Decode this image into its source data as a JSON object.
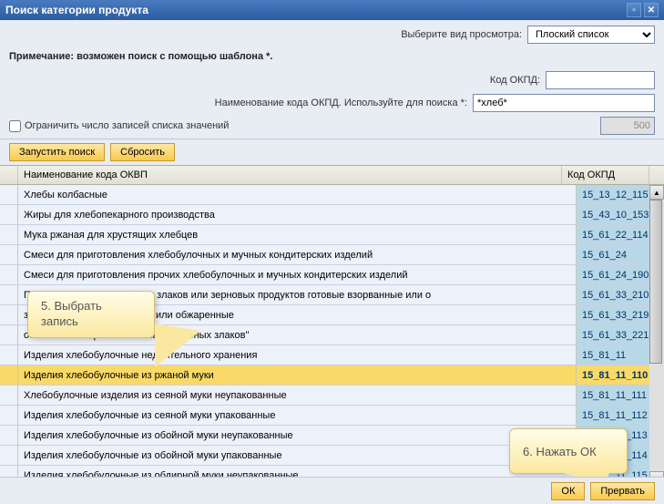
{
  "title": "Поиск категории продукта",
  "viewLabel": "Выберите вид просмотра:",
  "viewValue": "Плоский список",
  "note": "Примечание: возможен поиск с помощью шаблона *.",
  "codeLabel": "Код ОКПД:",
  "codeValue": "",
  "nameLabel": "Наименование кода ОКПД. Используйте для поиска *:",
  "nameValue": "*хлеб*",
  "limitLabel": "Ограничить число записей списка значений",
  "limitValue": "500",
  "runBtn": "Запустить поиск",
  "resetBtn": "Сбросить",
  "header": {
    "name": "Наименование кода ОКВП",
    "code": "Код ОКПД"
  },
  "rows": [
    {
      "name": "Хлебы колбасные",
      "code": "15_13_12_115"
    },
    {
      "name": "Жиры для хлебопекарного производства",
      "code": "15_43_10_153"
    },
    {
      "name": "Мука ржаная для хрустящих хлебцев",
      "code": "15_61_22_114"
    },
    {
      "name": "Смеси для приготовления хлебобулочных и мучных кондитерских изделий",
      "code": "15_61_24"
    },
    {
      "name": "Смеси для приготовления прочих хлебобулочных и мучных кондитерских изделий",
      "code": "15_61_24_190"
    },
    {
      "name": "Продукты из зерна хлебных злаков или зерновых продуктов готовые взорванные или о",
      "code": "15_61_33_210"
    },
    {
      "name": "злаков готовые взорванные или обжаренные",
      "code": "15_61_33_219"
    },
    {
      "name": "основе необжаренных хлопьев хлебных злаков\"",
      "code": "15_61_33_221"
    },
    {
      "name": "Изделия хлебобулочные недлительного хранения",
      "code": "15_81_11"
    },
    {
      "name": "Изделия хлебобулочные из ржаной муки",
      "code": "15_81_11_110",
      "sel": true
    },
    {
      "name": "Хлебобулочные изделия из сеяной муки неупакованные",
      "code": "15_81_11_111"
    },
    {
      "name": "Изделия хлебобулочные из сеяной муки упакованные",
      "code": "15_81_11_112"
    },
    {
      "name": "Изделия хлебобулочные из обойной муки неупакованные",
      "code": "15_81_11_113"
    },
    {
      "name": "Изделия хлебобулочные из обойной муки упакованные",
      "code": "15_81_11_114"
    },
    {
      "name": "Изделия хлебобулочные из обдирной муки неупакованные",
      "code": "15_81_11_115"
    }
  ],
  "okBtn": "ОК",
  "cancelBtn": "Прервать",
  "callout1": "5. Выбрать запись",
  "callout2": "6. Нажать ОК"
}
